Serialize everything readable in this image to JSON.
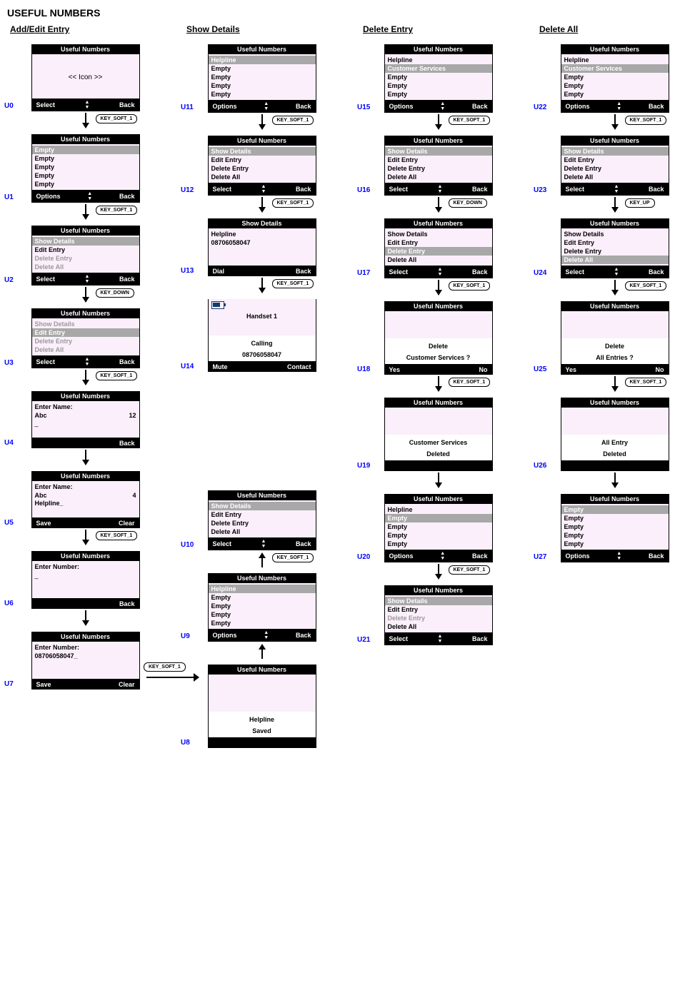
{
  "title": "USEFUL NUMBERS",
  "headings": {
    "add": "Add/Edit Entry",
    "show": "Show Details",
    "del": "Delete Entry",
    "all": "Delete All"
  },
  "soft": {
    "select": "Select",
    "back": "Back",
    "options": "Options",
    "save": "Save",
    "clear": "Clear",
    "dial": "Dial",
    "mute": "Mute",
    "contact": "Contact",
    "yes": "Yes",
    "no": "No"
  },
  "keys": {
    "soft1": "KEY_SOFT_1",
    "down": "KEY_DOWN",
    "up": "KEY_UP"
  },
  "labels": {
    "useful": "Useful Numbers",
    "showDetails": "Show Details",
    "editEntry": "Edit Entry",
    "deleteEntry": "Delete Entry",
    "deleteAll": "Delete All",
    "helpline": "Helpline",
    "custServ": "Customer Services",
    "empty": "Empty",
    "enterName": "Enter Name:",
    "enterNumber": "Enter Number:",
    "icon": "<< Icon >>",
    "handset": "Handset    1",
    "cursor": "_"
  },
  "tags": {
    "u0": "U0",
    "u1": "U1",
    "u2": "U2",
    "u3": "U3",
    "u4": "U4",
    "u5": "U5",
    "u6": "U6",
    "u7": "U7",
    "u8": "U8",
    "u9": "U9",
    "u10": "U10",
    "u11": "U11",
    "u12": "U12",
    "u13": "U13",
    "u14": "U14",
    "u15": "U15",
    "u16": "U16",
    "u17": "U17",
    "u18": "U18",
    "u19": "U19",
    "u20": "U20",
    "u21": "U21",
    "u22": "U22",
    "u23": "U23",
    "u24": "U24",
    "u25": "U25",
    "u26": "U26",
    "u27": "U27"
  },
  "u4": {
    "inputMode": "Abc",
    "counter": "12"
  },
  "u5": {
    "inputMode": "Abc",
    "counter": "4",
    "value": "Helpline_"
  },
  "u7": {
    "value": "08706058047_"
  },
  "u8": {
    "line1": "Helpline",
    "line2": "Saved"
  },
  "u13": {
    "name": "Helpline",
    "number": "08706058047"
  },
  "u14": {
    "line1": "Calling",
    "line2": "08706058047"
  },
  "u18": {
    "line1": "Delete",
    "line2": "Customer Services ?"
  },
  "u19": {
    "line1": "Customer Services",
    "line2": "Deleted"
  },
  "u25": {
    "line1": "Delete",
    "line2": "All Entries ?"
  },
  "u26": {
    "line1": "All Entry",
    "line2": "Deleted"
  }
}
